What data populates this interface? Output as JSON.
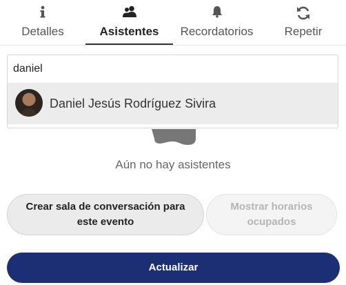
{
  "tabs": [
    {
      "label": "Detalles",
      "icon": "info-icon",
      "active": false
    },
    {
      "label": "Asistentes",
      "icon": "people-icon",
      "active": true
    },
    {
      "label": "Recordatorios",
      "icon": "bell-icon",
      "active": false
    },
    {
      "label": "Repetir",
      "icon": "refresh-icon",
      "active": false
    }
  ],
  "search": {
    "value": "daniel",
    "suggestions": [
      {
        "name": "Daniel Jesús Rodríguez Sivira",
        "avatar": "user-photo"
      }
    ]
  },
  "attendees": {
    "empty_text": "Aún no hay asistentes"
  },
  "actions": {
    "chat_room_label": "Crear sala de conversación para este evento",
    "busy_times_label": "Mostrar horarios ocupados",
    "update_label": "Actualizar"
  },
  "colors": {
    "primary": "#1c2e74",
    "tab_icon": "#555555"
  }
}
